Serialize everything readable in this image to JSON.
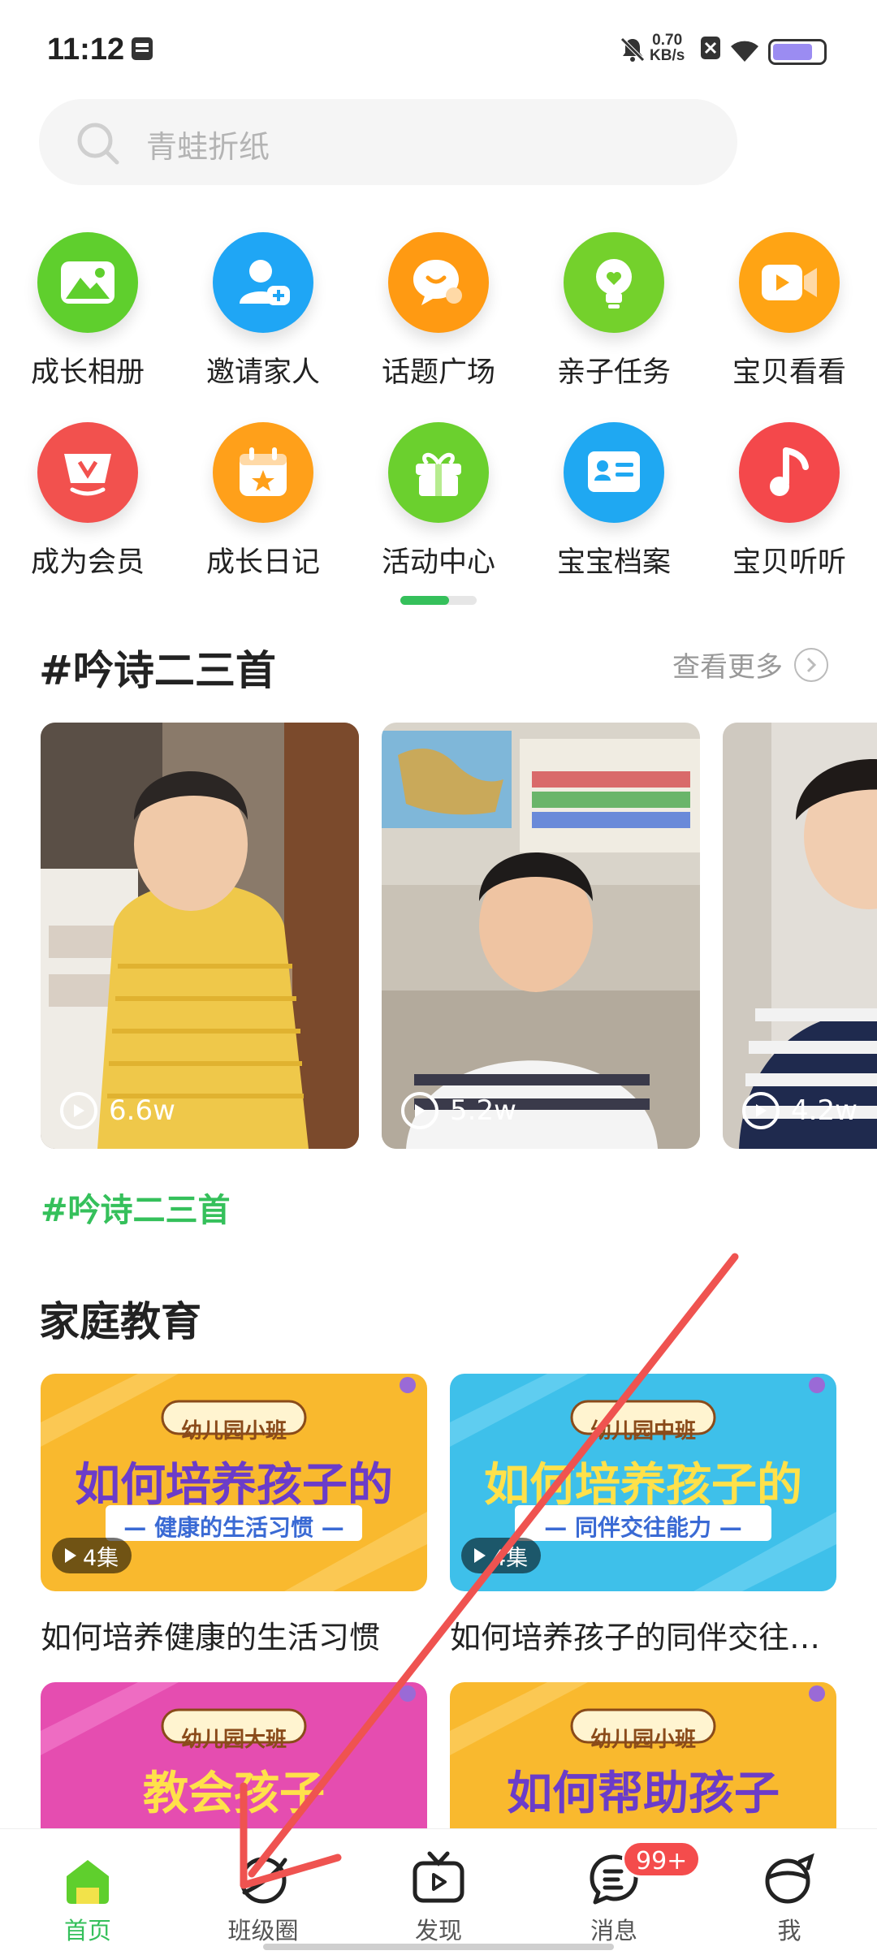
{
  "status_bar": {
    "time": "11:12",
    "net_speed_value": "0.70",
    "net_speed_unit": "KB/s",
    "battery_level": 0.8
  },
  "search": {
    "placeholder": "青蛙折纸"
  },
  "quick_grid": {
    "items": [
      {
        "label": "成长相册",
        "icon": "album-icon",
        "color": "#5fcf2d"
      },
      {
        "label": "邀请家人",
        "icon": "invite-family-icon",
        "color": "#1fa6f5"
      },
      {
        "label": "话题广场",
        "icon": "topic-chat-icon",
        "color": "#ff9a12"
      },
      {
        "label": "亲子任务",
        "icon": "bulb-task-icon",
        "color": "#74d12c"
      },
      {
        "label": "宝贝看看",
        "icon": "video-camera-icon",
        "color": "#ffa414"
      },
      {
        "label": "成为会员",
        "icon": "vip-crown-icon",
        "color": "#f2514e"
      },
      {
        "label": "成长日记",
        "icon": "calendar-diary-icon",
        "color": "#ffa01a"
      },
      {
        "label": "活动中心",
        "icon": "gift-icon",
        "color": "#6bd02e"
      },
      {
        "label": "宝宝档案",
        "icon": "profile-card-icon",
        "color": "#1fa8f2"
      },
      {
        "label": "宝贝听听",
        "icon": "music-note-icon",
        "color": "#f4484b"
      }
    ]
  },
  "poetry_section": {
    "title": "#吟诗二三首",
    "see_more": "查看更多",
    "videos": [
      {
        "views": "6.6w"
      },
      {
        "views": "5.2w"
      },
      {
        "views": "4.2w"
      }
    ],
    "hashtag": "#吟诗二三首"
  },
  "family_section": {
    "title": "家庭教育",
    "courses": [
      {
        "banner": "幼儿园小班",
        "headline": "如何培养孩子的",
        "subline": "— 健康的生活习惯 —",
        "episodes": "4集",
        "title": "如何培养健康的生活习惯",
        "bg": "#f9b92e"
      },
      {
        "banner": "幼儿园中班",
        "headline": "如何培养孩子的",
        "subline": "— 同伴交往能力 —",
        "episodes": "4集",
        "title": "如何培养孩子的同伴交往能力",
        "bg": "#3ec0ea"
      },
      {
        "banner": "幼儿园大班",
        "headline": "教会孩子",
        "subline": "",
        "episodes": "",
        "title": "",
        "bg": "#e54db0"
      },
      {
        "banner": "幼儿园小班",
        "headline": "如何帮助孩子",
        "subline": "",
        "episodes": "",
        "title": "",
        "bg": "#f9b92e"
      }
    ]
  },
  "bottom_nav": {
    "items": [
      {
        "label": "首页",
        "icon": "home-icon",
        "active": true
      },
      {
        "label": "班级圈",
        "icon": "class-circle-icon",
        "active": false
      },
      {
        "label": "发现",
        "icon": "tv-discover-icon",
        "active": false
      },
      {
        "label": "消息",
        "icon": "message-icon",
        "active": false,
        "badge": "99+"
      },
      {
        "label": "我",
        "icon": "profile-icon",
        "active": false
      }
    ]
  },
  "colors": {
    "accent": "#35c05b",
    "annotation_arrow": "#ef5350"
  }
}
